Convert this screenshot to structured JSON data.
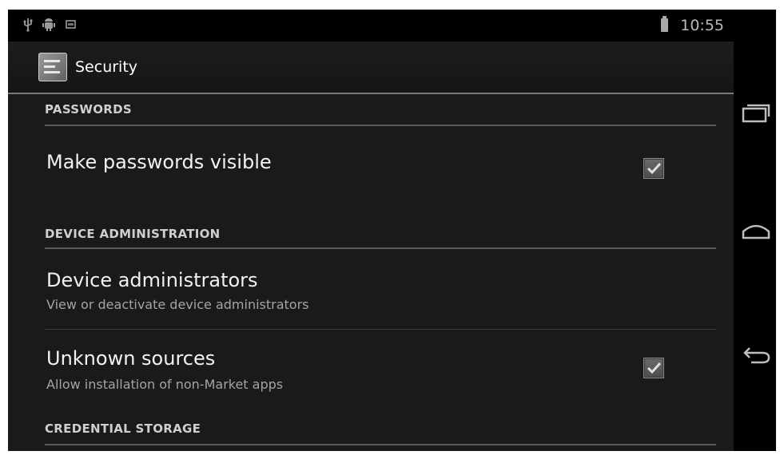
{
  "status_bar": {
    "time": "10:55",
    "icons": [
      "usb-icon",
      "android-debug-icon",
      "notification-icon",
      "battery-icon"
    ]
  },
  "action_bar": {
    "title": "Security",
    "icon": "settings-app-icon"
  },
  "sections": [
    {
      "header": "PASSWORDS",
      "items": [
        {
          "title": "Make passwords visible",
          "summary": "",
          "checked": true
        }
      ]
    },
    {
      "header": "DEVICE ADMINISTRATION",
      "items": [
        {
          "title": "Device administrators",
          "summary": "View or deactivate device administrators"
        },
        {
          "title": "Unknown sources",
          "summary": "Allow installation of non-Market apps",
          "checked": true
        }
      ]
    },
    {
      "header": "CREDENTIAL STORAGE",
      "items": []
    }
  ],
  "nav_bar": {
    "buttons": [
      "recent-apps-icon",
      "home-icon",
      "back-icon"
    ]
  },
  "colors": {
    "background": "#1a1a1a",
    "title_text": "#f2f2f2",
    "summary_text": "#a4a4a4",
    "section_header": "#cfcfcf"
  }
}
